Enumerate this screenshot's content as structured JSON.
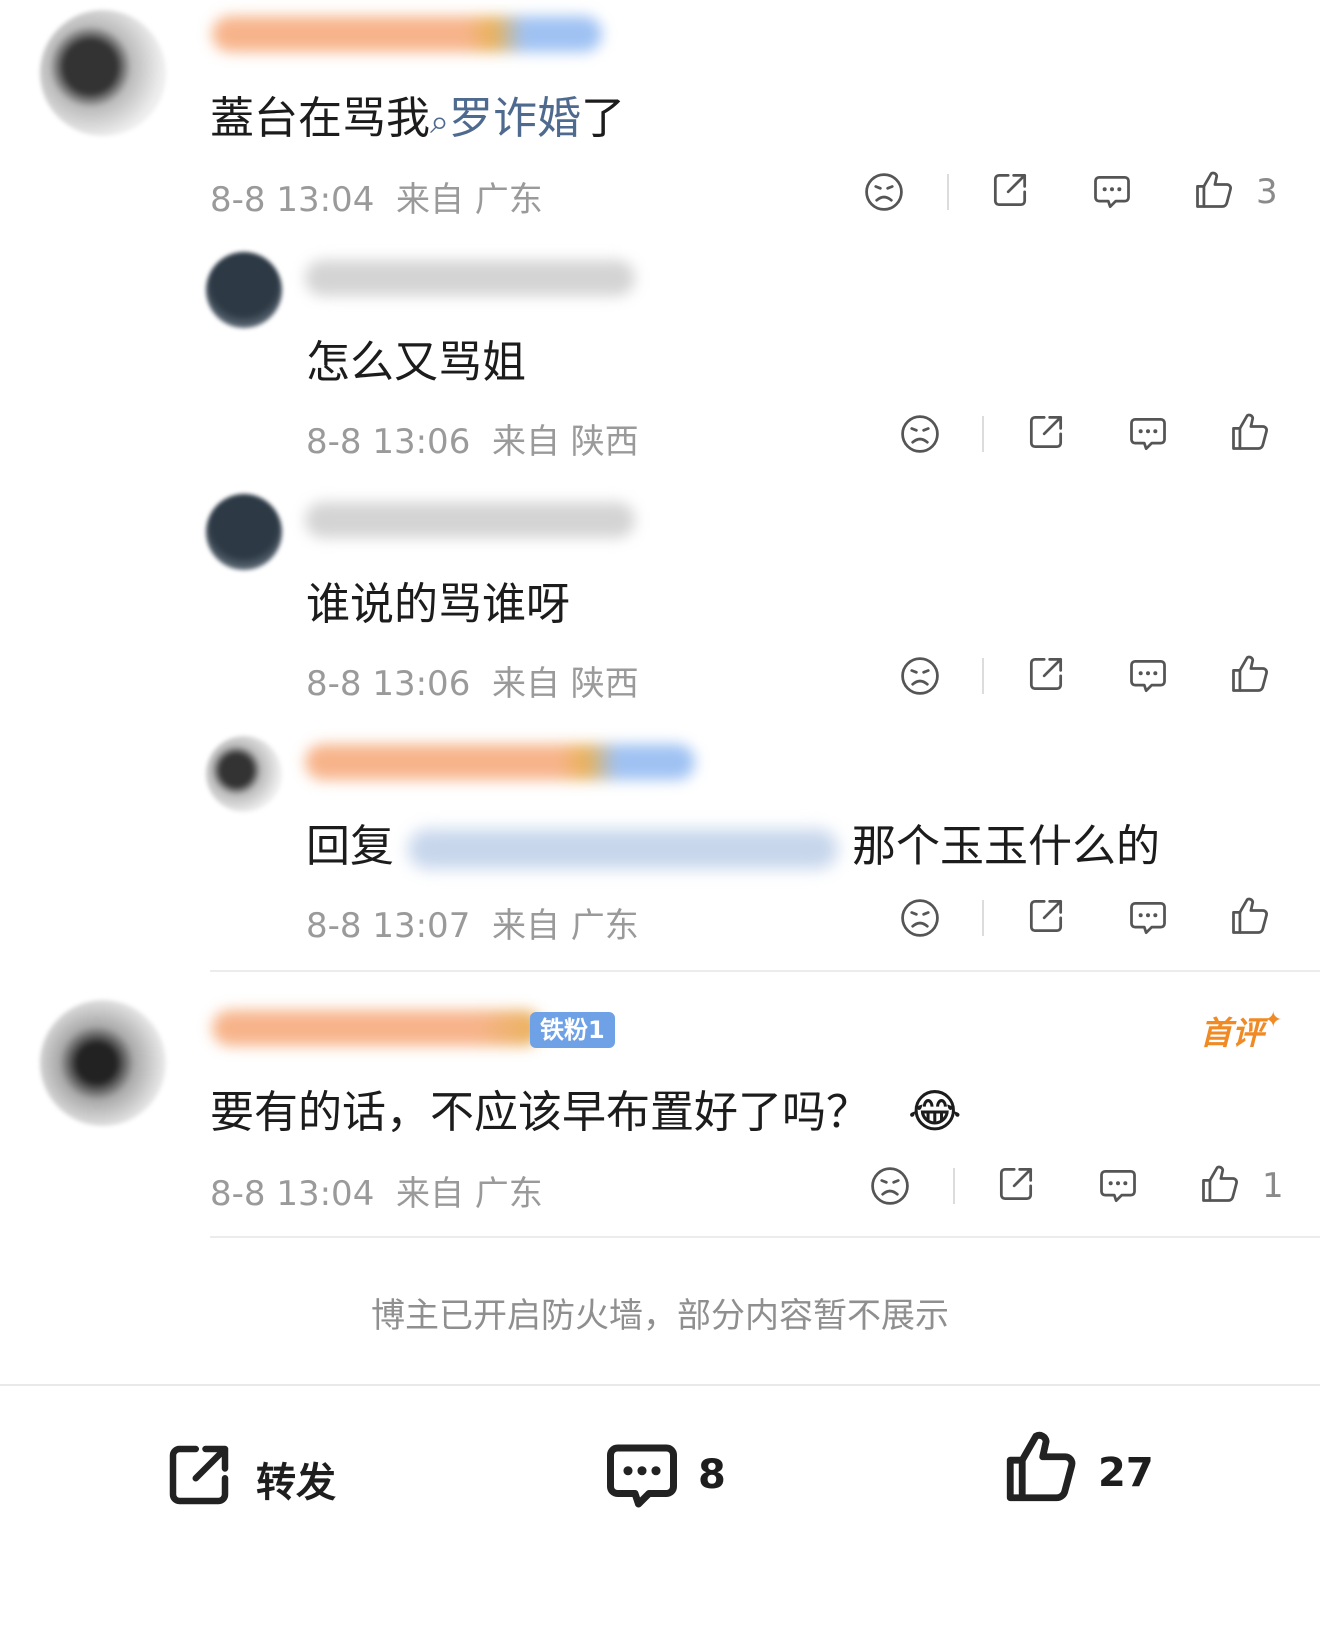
{
  "comments": [
    {
      "text_prefix": "蓋台在骂我",
      "text_link": "罗诈婚",
      "text_suffix": "了",
      "time": "8-8 13:04",
      "location": "来自 广东",
      "likes": "3"
    },
    {
      "text": "怎么又骂姐",
      "time": "8-8 13:06",
      "location": "来自 陕西"
    },
    {
      "text": "谁说的骂谁呀",
      "time": "8-8 13:06",
      "location": "来自 陕西"
    },
    {
      "text_prefix": "回复",
      "text_suffix": "那个玉玉什么的",
      "time": "8-8 13:07",
      "location": "来自 广东"
    },
    {
      "badge": "铁粉1",
      "first_comment_tag": "首评",
      "text": "要有的话，不应该早布置好了吗？",
      "emoji": "😂",
      "time": "8-8 13:04",
      "location": "来自 广东",
      "likes": "1"
    }
  ],
  "firewall_notice": "博主已开启防火墙，部分内容暂不展示",
  "bottom_bar": {
    "repost_label": "转发",
    "comment_count": "8",
    "like_count": "27"
  },
  "icons": [
    "dislike-icon",
    "share-icon",
    "comment-icon",
    "like-icon"
  ],
  "colors": {
    "accent_link": "#4f6a8f",
    "first_comment": "#f08a24",
    "meta": "#9a9a9a"
  }
}
